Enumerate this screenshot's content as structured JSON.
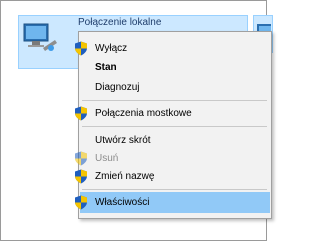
{
  "window": {
    "connection_label": "Połączenie lokalne"
  },
  "context_menu": {
    "items": [
      {
        "label": "Wyłącz",
        "icon": "uac-shield-icon",
        "style": "normal"
      },
      {
        "label": "Stan",
        "icon": null,
        "style": "bold"
      },
      {
        "label": "Diagnozuj",
        "icon": null,
        "style": "normal"
      },
      {
        "label": "Połączenia mostkowe",
        "icon": "uac-shield-icon",
        "style": "normal"
      },
      {
        "label": "Utwórz skrót",
        "icon": null,
        "style": "normal"
      },
      {
        "label": "Usuń",
        "icon": "uac-shield-icon",
        "style": "disabled"
      },
      {
        "label": "Zmień nazwę",
        "icon": "uac-shield-icon",
        "style": "normal"
      },
      {
        "label": "Właściwości",
        "icon": "uac-shield-icon",
        "style": "hover"
      }
    ]
  },
  "colors": {
    "selection_bg": "#cce8ff",
    "menu_bg": "#f2f2f2",
    "hover_bg": "#91c9f7",
    "shield_blue": "#1f5fbf",
    "shield_yellow": "#f5c400"
  }
}
